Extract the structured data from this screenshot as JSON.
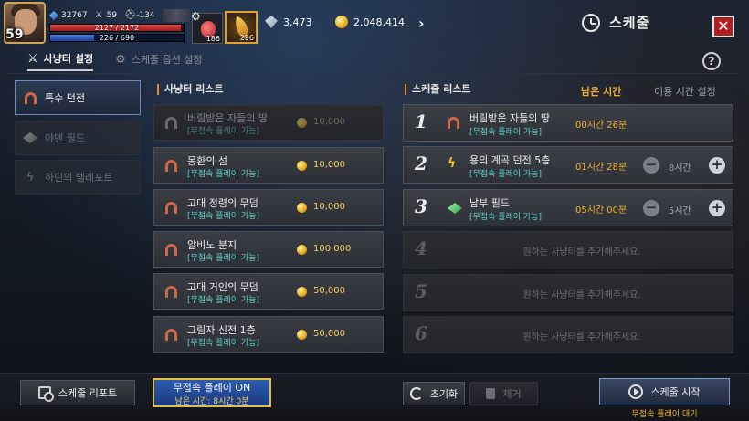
{
  "player": {
    "level": "59",
    "power": "32767",
    "attack": "59",
    "defense": "-134",
    "hp": "2127 / 2172",
    "mp": "226 / 690",
    "hp_fraction": 0.979,
    "mp_fraction": 0.328
  },
  "items": {
    "potion_count": "186",
    "feather_count": "296"
  },
  "currency": {
    "diamond": "3,473",
    "gold": "2,048,414"
  },
  "title": "스케줄",
  "tabs": {
    "hunting_settings": "사냥터 설정",
    "schedule_options": "스케줄 옵션 설정"
  },
  "categories": [
    {
      "label": "특수 던전",
      "icon": "arch-icon",
      "active": true
    },
    {
      "label": "야덴 필드",
      "icon": "field-icon",
      "active": false
    },
    {
      "label": "하딘의 텔레포트",
      "icon": "bolt-icon",
      "active": false
    }
  ],
  "hunting_list": {
    "header": "사냥터 리스트",
    "items": [
      {
        "name": "버림받은 자들의 땅",
        "sub": "[무접속 플레이 가능]",
        "price": "10,000",
        "disabled": true
      },
      {
        "name": "몽환의 섬",
        "sub": "[무접속 플레이 가능]",
        "price": "10,000",
        "disabled": false
      },
      {
        "name": "고대 정령의 무덤",
        "sub": "[무접속 플레이 가능]",
        "price": "10,000",
        "disabled": false
      },
      {
        "name": "알비노 분지",
        "sub": "[무접속 플레이 가능]",
        "price": "100,000",
        "disabled": false
      },
      {
        "name": "고대 거인의 무덤",
        "sub": "[무접속 플레이 가능]",
        "price": "50,000",
        "disabled": false
      },
      {
        "name": "그림자 신전 1층",
        "sub": "[무접속 플레이 가능]",
        "price": "50,000",
        "disabled": false
      }
    ]
  },
  "schedule_list": {
    "header": "스케줄 리스트",
    "col_remaining": "남은 시간",
    "col_usage": "이용 시간 설정",
    "entries": [
      {
        "num": "1",
        "name": "버림받은 자들의 땅",
        "sub": "[무접속 플레이 가능]",
        "time": "00시간 26분",
        "hours": "",
        "icon": "arch"
      },
      {
        "num": "2",
        "name": "용의 계곡 던전 5층",
        "sub": "[무접속 플레이 가능]",
        "time": "01시간 28분",
        "hours": "8시간",
        "icon": "bolt"
      },
      {
        "num": "3",
        "name": "남부 필드",
        "sub": "[무접속 플레이 가능]",
        "time": "05시간 00분",
        "hours": "5시간",
        "icon": "field"
      }
    ],
    "empty_entries": [
      {
        "num": "4",
        "hint": "원하는 사냥터를 추가해주세요."
      },
      {
        "num": "5",
        "hint": "원하는 사냥터를 추가해주세요."
      },
      {
        "num": "6",
        "hint": "원하는 사냥터를 추가해주세요."
      }
    ]
  },
  "bottom": {
    "report": "스케줄 리포트",
    "offline_on": "무접속 플레이 ON",
    "offline_remaining": "남은 시간: 8시간 0분",
    "reset": "초기화",
    "remove": "제거",
    "start": "스케줄 시작",
    "start_sub": "무접속 플레이 대기"
  },
  "colors": {
    "accent_gold": "#f0b030",
    "teal_sub": "#5ad0c8",
    "close_red": "#b02020",
    "offline_blue": "#2a5cb0"
  }
}
